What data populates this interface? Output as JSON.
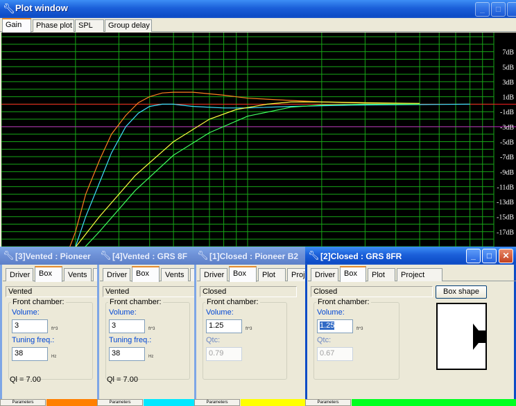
{
  "window": {
    "title": "Plot window",
    "icon": "wrench-icon",
    "minimize": "_",
    "maximize": "□",
    "close": "✕"
  },
  "tabs": [
    {
      "label": "Gain",
      "active": true
    },
    {
      "label": "Phase plot",
      "active": false
    },
    {
      "label": "SPL",
      "active": false
    },
    {
      "label": "Group delay",
      "active": false
    }
  ],
  "chart_data": {
    "type": "line",
    "x_scale": "log",
    "y_tick_labels": [
      "7dB",
      "5dB",
      "3dB",
      "1dB",
      "-1dB",
      "-3dB",
      "-5dB",
      "-7dB",
      "-9dB",
      "-11dB",
      "-13dB",
      "-15dB",
      "-17dB"
    ],
    "ylim": [
      -19,
      9
    ],
    "reference_lines": [
      {
        "y": 0,
        "color": "#ff2020"
      },
      {
        "y": -3,
        "color": "#c020c0"
      }
    ],
    "grid": true,
    "colors": {
      "background": "#000000",
      "grid": "#17a717"
    },
    "series": [
      {
        "color": "#ff8020",
        "x": [
          18,
          20,
          22,
          25,
          28,
          32,
          36,
          40,
          45,
          50,
          60,
          80,
          100,
          150,
          200,
          300,
          500
        ],
        "y": [
          -21,
          -17,
          -12,
          -7.5,
          -4,
          -1.5,
          0.2,
          1.0,
          1.5,
          1.6,
          1.6,
          1.2,
          0.8,
          0.5,
          0.3,
          0.15,
          0.1
        ]
      },
      {
        "color": "#40e0ff",
        "x": [
          18,
          20,
          22,
          25,
          28,
          32,
          36,
          40,
          45,
          50,
          60,
          80,
          100,
          150,
          200,
          300,
          500,
          800
        ],
        "y": [
          -22,
          -19,
          -15,
          -10.5,
          -6.5,
          -3,
          -1.2,
          -0.3,
          0,
          0,
          -0.3,
          -0.5,
          -0.5,
          -0.3,
          -0.2,
          -0.1,
          -0.05,
          0
        ]
      },
      {
        "color": "#ffff40",
        "x": [
          18,
          25,
          35,
          50,
          70,
          90,
          120,
          150,
          200,
          300,
          500
        ],
        "y": [
          -21,
          -15,
          -9.5,
          -5,
          -2,
          -0.7,
          0,
          0.3,
          0.3,
          0.2,
          0.1
        ]
      },
      {
        "color": "#40ff60",
        "x": [
          18,
          25,
          35,
          50,
          70,
          100,
          150,
          200,
          300,
          500
        ],
        "y": [
          -22,
          -17,
          -11.5,
          -6.8,
          -3.8,
          -1.6,
          -0.4,
          -0.1,
          0,
          0
        ]
      }
    ]
  },
  "subwindows": [
    {
      "title": "[3]Vented : Pioneer",
      "active": false,
      "tabs": [
        "Driver",
        "Box",
        "Vents",
        "P"
      ],
      "box_type": "Vented",
      "group_label": "Front chamber:",
      "field1_label": "Volume:",
      "field1_value": "3",
      "field1_unit": "ft^3",
      "field2_label": "Tuning freq.:",
      "field2_value": "38",
      "field2_unit": "Hz",
      "ql": "Ql = 7.00",
      "params_label": "Parameters",
      "color": "#ff8000"
    },
    {
      "title": "[4]Vented : GRS 8F",
      "active": false,
      "tabs": [
        "Driver",
        "Box",
        "Vents",
        "P"
      ],
      "box_type": "Vented",
      "group_label": "Front chamber:",
      "field1_label": "Volume:",
      "field1_value": "3",
      "field1_unit": "ft^3",
      "field2_label": "Tuning freq.:",
      "field2_value": "38",
      "field2_unit": "Hz",
      "ql": "Ql = 7.00",
      "params_label": "Parameters",
      "color": "#00e8ff"
    },
    {
      "title": "[1]Closed : Pioneer B2",
      "active": false,
      "tabs": [
        "Driver",
        "Box",
        "Plot",
        "Proje"
      ],
      "box_type": "Closed",
      "group_label": "Front chamber:",
      "field1_label": "Volume:",
      "field1_value": "1.25",
      "field1_unit": "ft^3",
      "field2_label": "Qtc:",
      "field2_value": "0.79",
      "params_label": "Parameters",
      "color": "#ffff00"
    },
    {
      "title": "[2]Closed : GRS 8FR",
      "active": true,
      "tabs": [
        "Driver",
        "Box",
        "Plot",
        "Project"
      ],
      "box_type": "Closed",
      "box_shape_button": "Box shape",
      "group_label": "Front chamber:",
      "field1_label": "Volume:",
      "field1_value": "1.25",
      "field1_unit": "ft^3",
      "field2_label": "Qtc:",
      "field2_value": "0.67",
      "params_label": "Parameters",
      "color": "#00ff20"
    }
  ]
}
